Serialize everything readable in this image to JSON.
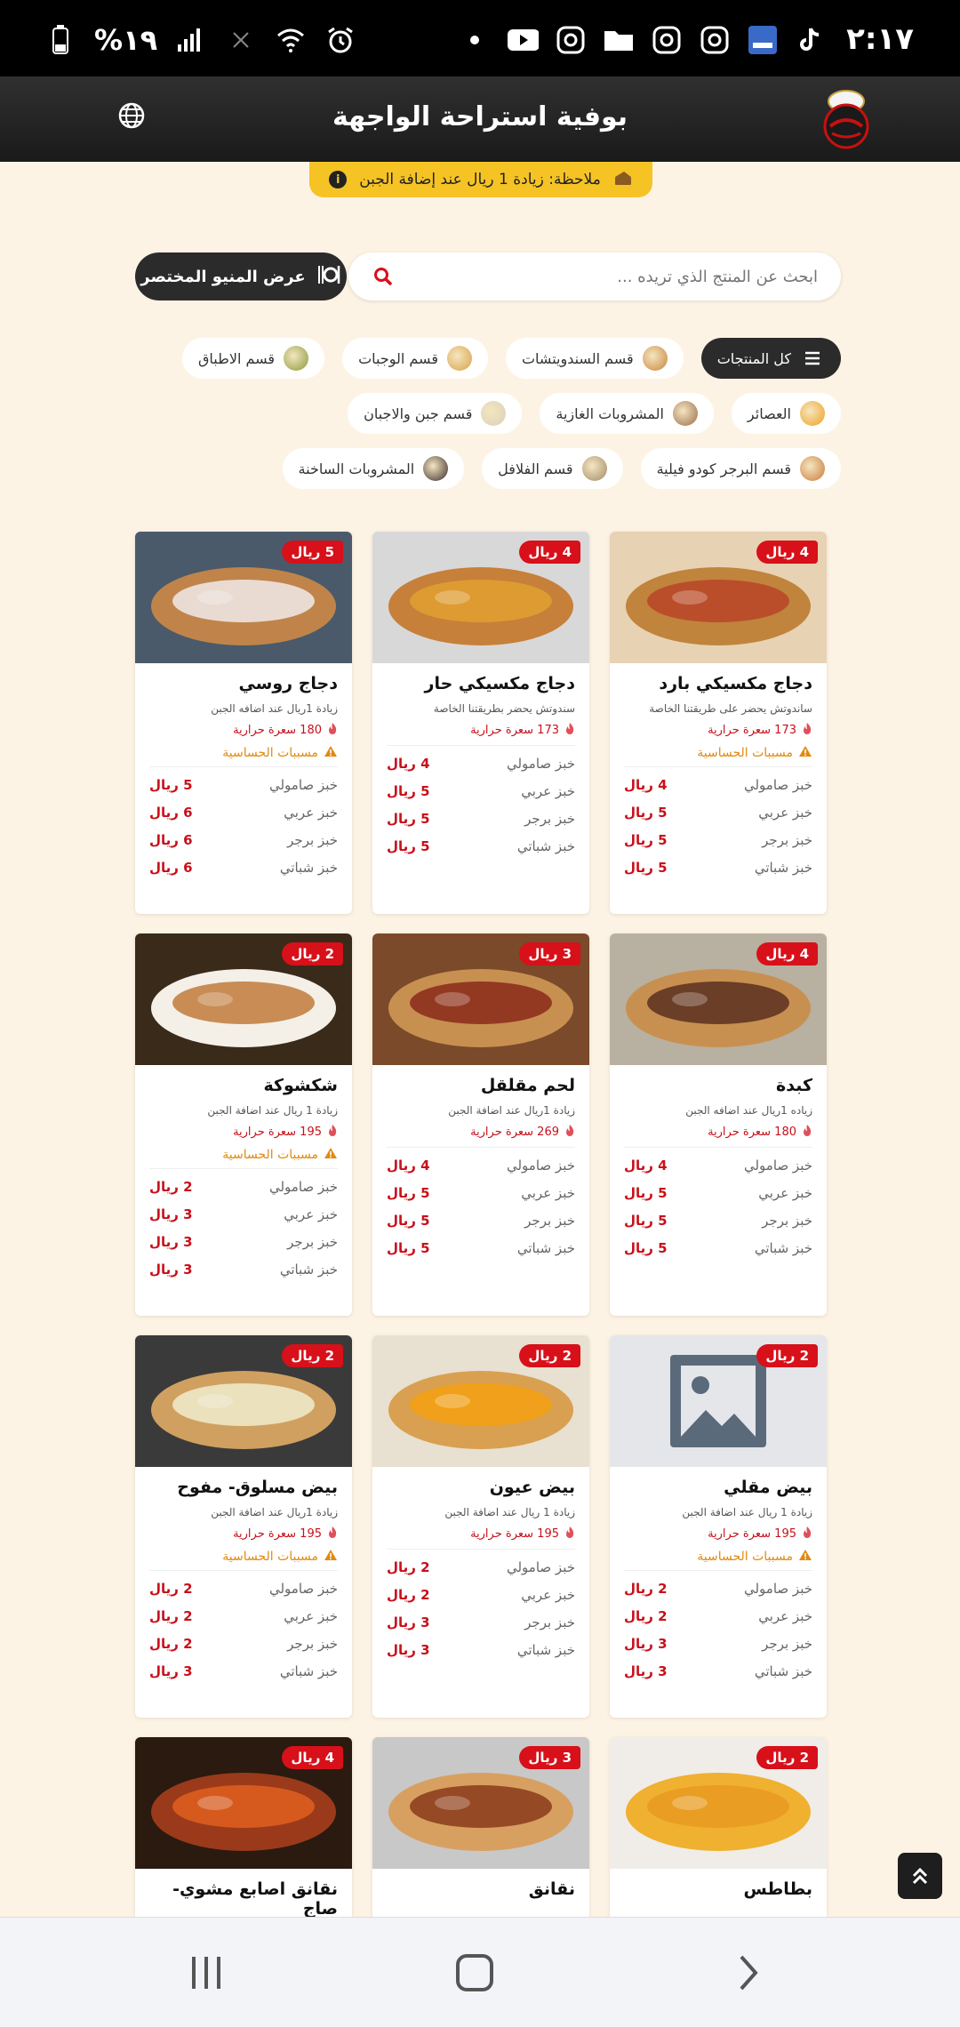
{
  "status": {
    "time": "٢:١٧",
    "battery": "%١٩"
  },
  "header": {
    "title": "بوفية استراحة الواجهة",
    "logo_text": "الواجهة"
  },
  "note": {
    "text": "ملاحظة: زيادة 1 ريال عند إضافة الجبن"
  },
  "search": {
    "placeholder": "ابحث عن المنتج الذي تريده ..."
  },
  "menu_button": {
    "label": "عرض المنيو المختصر"
  },
  "categories": [
    {
      "label": "كل المنتجات",
      "icon": "list-icon",
      "color": "#ffffff",
      "active": true
    },
    {
      "label": "قسم السندويتشات",
      "icon": "sandwich-icon",
      "color": "#c8843a"
    },
    {
      "label": "قسم الوجبات",
      "icon": "meal-icon",
      "color": "#d9a146"
    },
    {
      "label": "قسم الاطباق",
      "icon": "dish-icon",
      "color": "#8a9a3a"
    },
    {
      "label": "العصائر",
      "icon": "juice-icon",
      "color": "#f0a020"
    },
    {
      "label": "المشروبات الغازية",
      "icon": "soda-icon",
      "color": "#9a6a4a"
    },
    {
      "label": "قسم جبن والاجبان",
      "icon": "cheese-icon",
      "color": "#d8d0b8"
    },
    {
      "label": "قسم البرجر كودو فيلية",
      "icon": "burger-icon",
      "color": "#c87a3a"
    },
    {
      "label": "قسم الفلافل",
      "icon": "falafel-icon",
      "color": "#a08a6a"
    },
    {
      "label": "المشروبات الساخنة",
      "icon": "hot-drink-icon",
      "color": "#3a2a2a"
    }
  ],
  "allergy_label": "مسببات الحساسية",
  "products": [
    {
      "name": "دجاج مكسيكي بارد",
      "badge": "4 ريال",
      "desc": "ساندوتش يحضر على طريقتنا الخاصة",
      "calories": "173 سعرة حرارية",
      "allergy": true,
      "img": [
        "#e8d2b4",
        "#c0843c",
        "#b84428"
      ],
      "prices": [
        [
          "خبز صامولي",
          "4 ريال"
        ],
        [
          "خبز عربي",
          "5 ريال"
        ],
        [
          "خبز برجر",
          "5 ريال"
        ],
        [
          "خبز شباتي",
          "5 ريال"
        ]
      ]
    },
    {
      "name": "دجاج مكسيكي حار",
      "badge": "4 ريال",
      "desc": "سندوتش يحضر بطريقتنا الخاصة",
      "calories": "173 سعرة حرارية",
      "allergy": false,
      "img": [
        "#d8d8d8",
        "#c6803a",
        "#e0a030"
      ],
      "prices": [
        [
          "خبز صامولي",
          "4 ريال"
        ],
        [
          "خبز عربي",
          "5 ريال"
        ],
        [
          "خبز برجر",
          "5 ريال"
        ],
        [
          "خبز شباتي",
          "5 ريال"
        ]
      ]
    },
    {
      "name": "دجاج روسي",
      "badge": "5 ريال",
      "desc": "زيادة 1ريال عند اضافه الجبن",
      "calories": "180 سعرة حرارية",
      "allergy": true,
      "img": [
        "#4a5a6a",
        "#c0844a",
        "#f0eaea"
      ],
      "prices": [
        [
          "خبز صامولي",
          "5 ريال"
        ],
        [
          "خبز عربي",
          "6 ريال"
        ],
        [
          "خبز برجر",
          "6 ريال"
        ],
        [
          "خبز شباتي",
          "6 ريال"
        ]
      ]
    },
    {
      "name": "كبدة",
      "badge": "4 ريال",
      "desc": "زياده 1ريال عند اضافه الجبن",
      "calories": "180 سعرة حرارية",
      "allergy": false,
      "img": [
        "#b8b0a0",
        "#c89050",
        "#5a3020"
      ],
      "prices": [
        [
          "خبز صامولي",
          "4 ريال"
        ],
        [
          "خبز عربي",
          "5 ريال"
        ],
        [
          "خبز برجر",
          "5 ريال"
        ],
        [
          "خبز شباتي",
          "5 ريال"
        ]
      ]
    },
    {
      "name": "لحم مقلقل",
      "badge": "3 ريال",
      "desc": "زيادة 1ريال عند اضافة الجبن",
      "calories": "269 سعرة حرارية",
      "allergy": false,
      "img": [
        "#7a4a2a",
        "#c89050",
        "#8a2a1a"
      ],
      "prices": [
        [
          "خبز صامولي",
          "4 ريال"
        ],
        [
          "خبز عربي",
          "5 ريال"
        ],
        [
          "خبز برجر",
          "5 ريال"
        ],
        [
          "خبز شباتي",
          "5 ريال"
        ]
      ]
    },
    {
      "name": "شكشوكة",
      "badge": "2 ريال",
      "desc": "زيادة 1 ريال عند اضافة الجبن",
      "calories": "195 سعرة حرارية",
      "allergy": true,
      "img": [
        "#3a2a1a",
        "#f4f0e8",
        "#c07a3a"
      ],
      "prices": [
        [
          "خبز صامولي",
          "2 ريال"
        ],
        [
          "خبز عربي",
          "3 ريال"
        ],
        [
          "خبز برجر",
          "3 ريال"
        ],
        [
          "خبز شباتي",
          "3 ريال"
        ]
      ]
    },
    {
      "name": "بيض مقلي",
      "badge": "2 ريال",
      "desc": "زيادة 1 ريال عند اضافة الجبن",
      "calories": "195 سعرة حرارية",
      "allergy": true,
      "img": [
        "#e4e6ea",
        "#5a6a7a",
        "#5a6a7a"
      ],
      "placeholder": true,
      "prices": [
        [
          "خبز صامولي",
          "2 ريال"
        ],
        [
          "خبز عربي",
          "2 ريال"
        ],
        [
          "خبز برجر",
          "3 ريال"
        ],
        [
          "خبز شباتي",
          "3 ريال"
        ]
      ]
    },
    {
      "name": "بيض عيون",
      "badge": "2 ريال",
      "desc": "زيادة 1 ريال عند اضافة الجبن",
      "calories": "195 سعرة حرارية",
      "allergy": false,
      "img": [
        "#e8e0d0",
        "#d8a050",
        "#f4a010"
      ],
      "prices": [
        [
          "خبز صامولي",
          "2 ريال"
        ],
        [
          "خبز عربي",
          "2 ريال"
        ],
        [
          "خبز برجر",
          "3 ريال"
        ],
        [
          "خبز شباتي",
          "3 ريال"
        ]
      ]
    },
    {
      "name": "بيض مسلوق- مفوح",
      "badge": "2 ريال",
      "desc": "زيادة 1ريال عند اضافة الجبن",
      "calories": "195 سعرة حرارية",
      "allergy": true,
      "img": [
        "#3a3a3a",
        "#d0a060",
        "#f0eccc"
      ],
      "prices": [
        [
          "خبز صامولي",
          "2 ريال"
        ],
        [
          "خبز عربي",
          "2 ريال"
        ],
        [
          "خبز برجر",
          "2 ريال"
        ],
        [
          "خبز شباتي",
          "3 ريال"
        ]
      ]
    },
    {
      "name": "بطاطس",
      "badge": "2 ريال",
      "desc": "",
      "calories": "",
      "allergy": false,
      "img": [
        "#f0ede8",
        "#f0b030",
        "#e89a20"
      ],
      "prices": []
    },
    {
      "name": "نقانق",
      "badge": "3 ريال",
      "desc": "",
      "calories": "",
      "allergy": false,
      "img": [
        "#c8c8c8",
        "#d8a060",
        "#8a3a1a"
      ],
      "prices": []
    },
    {
      "name": "نقانق اصابع مشوي-صاج",
      "badge": "4 ريال",
      "desc": "",
      "calories": "",
      "allergy": false,
      "img": [
        "#2a1a10",
        "#9a3a1a",
        "#e06020"
      ],
      "prices": []
    }
  ]
}
